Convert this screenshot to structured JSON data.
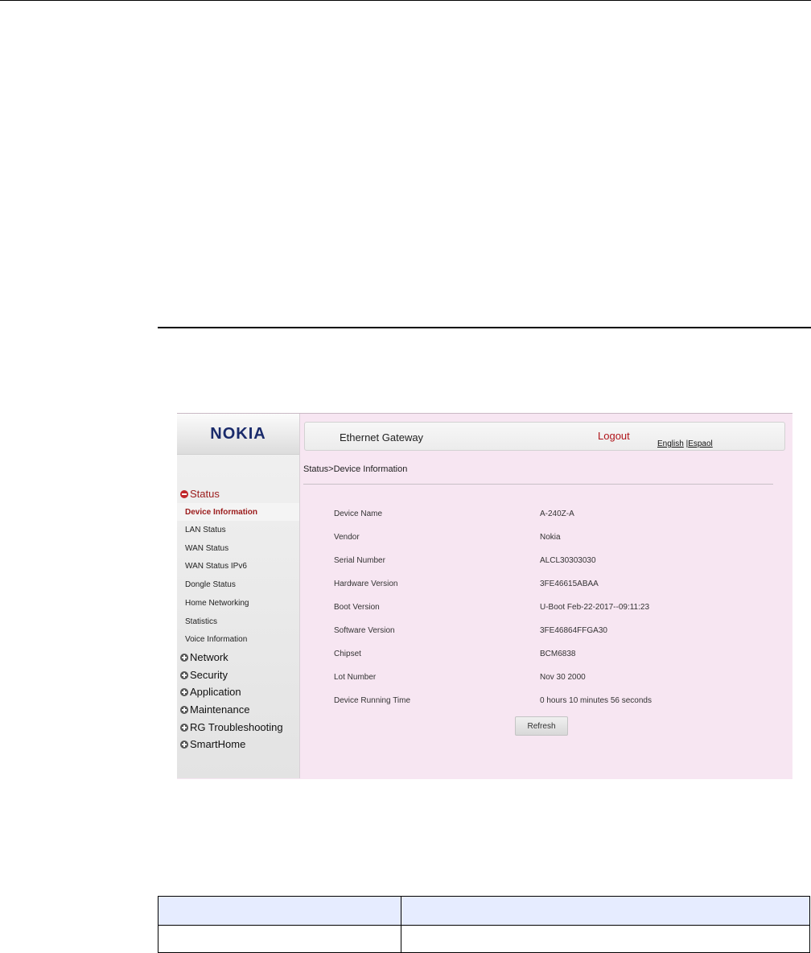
{
  "brand": {
    "logo": "NOKIA"
  },
  "header": {
    "title": "Ethernet Gateway",
    "logout": "Logout",
    "lang_english": "English",
    "lang_sep": " |",
    "lang_espanol": "Espaol"
  },
  "breadcrumb": "Status>Device Information",
  "sidebar": {
    "status": {
      "label": "Status",
      "expanded": true
    },
    "status_items": [
      {
        "label": "Device Information",
        "active": true
      },
      {
        "label": "LAN Status"
      },
      {
        "label": "WAN Status"
      },
      {
        "label": "WAN Status IPv6"
      },
      {
        "label": "Dongle Status"
      },
      {
        "label": "Home Networking"
      },
      {
        "label": "Statistics"
      },
      {
        "label": "Voice Information"
      }
    ],
    "groups": [
      {
        "label": "Network"
      },
      {
        "label": "Security"
      },
      {
        "label": "Application"
      },
      {
        "label": "Maintenance"
      },
      {
        "label": "RG Troubleshooting"
      },
      {
        "label": "SmartHome"
      }
    ]
  },
  "device_info": [
    {
      "label": "Device Name",
      "value": "A-240Z-A"
    },
    {
      "label": "Vendor",
      "value": "Nokia"
    },
    {
      "label": "Serial Number",
      "value": "ALCL30303030"
    },
    {
      "label": "Hardware Version",
      "value": "3FE46615ABAA"
    },
    {
      "label": "Boot Version",
      "value": "U-Boot Feb-22-2017--09:11:23"
    },
    {
      "label": "Software Version",
      "value": "3FE46864FFGA30"
    },
    {
      "label": "Chipset",
      "value": "BCM6838"
    },
    {
      "label": "Lot Number",
      "value": "Nov 30 2000"
    },
    {
      "label": "Device Running Time",
      "value": "0 hours 10 minutes 56 seconds"
    }
  ],
  "buttons": {
    "refresh": "Refresh"
  },
  "colors": {
    "accent": "#9b1b1b",
    "panel_bg": "#f7e6f2",
    "table_header": "#e6ecff"
  }
}
